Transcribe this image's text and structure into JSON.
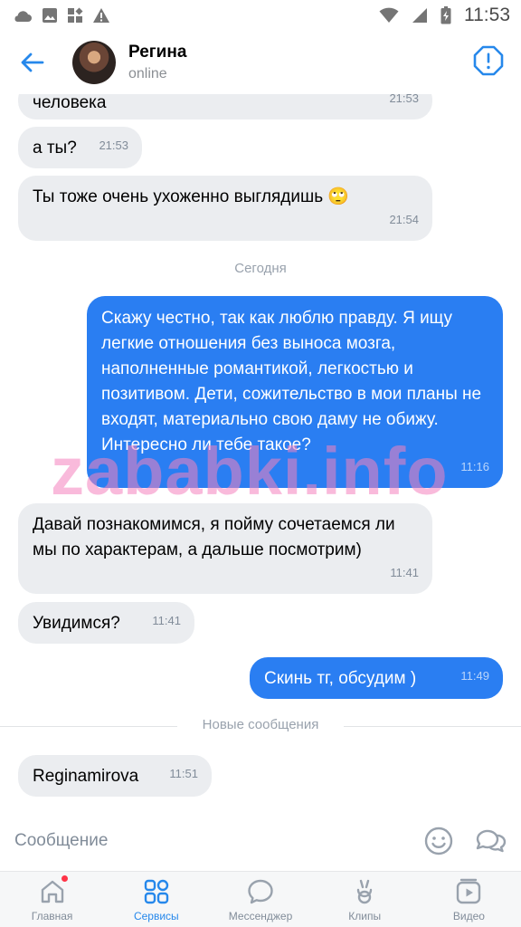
{
  "status_bar": {
    "time": "11:53"
  },
  "header": {
    "name": "Регина",
    "status": "online"
  },
  "messages": [
    {
      "text": "человека",
      "time": "21:53",
      "dir": "in"
    },
    {
      "text": "а ты?",
      "time": "21:53",
      "dir": "in"
    },
    {
      "text": "Ты тоже очень ухоженно выглядишь 🙄",
      "time": "21:54",
      "dir": "in"
    },
    {
      "text": "Скажу честно, так как люблю правду. Я ищу легкие отношения без выноса мозга, наполненные романтикой, легкостью и позитивом. Дети, сожительство в мои планы не входят, материально свою даму не обижу. Интересно ли тебе такое?",
      "time": "11:16",
      "dir": "out"
    },
    {
      "text": "Давай познакомимся, я пойму сочетаемся ли мы по характерам, а дальше посмотрим)",
      "time": "11:41",
      "dir": "in"
    },
    {
      "text": "Увидимся?",
      "time": "11:41",
      "dir": "in"
    },
    {
      "text": "Скинь тг, обсудим )",
      "time": "11:49",
      "dir": "out"
    },
    {
      "text": "Reginamirova",
      "time": "11:51",
      "dir": "in"
    }
  ],
  "separators": {
    "today": "Сегодня",
    "new_messages": "Новые сообщения"
  },
  "watermark": "zababki.info",
  "composer": {
    "placeholder": "Сообщение"
  },
  "tabs": [
    {
      "label": "Главная",
      "icon": "home-icon",
      "active": false,
      "badge": true
    },
    {
      "label": "Сервисы",
      "icon": "services-grid-icon",
      "active": true
    },
    {
      "label": "Мессенджер",
      "icon": "messenger-icon",
      "active": false
    },
    {
      "label": "Клипы",
      "icon": "clips-icon",
      "active": false
    },
    {
      "label": "Видео",
      "icon": "video-icon",
      "active": false
    }
  ],
  "colors": {
    "accent": "#2688eb",
    "outgoing_bubble": "#2a7ef2",
    "incoming_bubble": "#ebedf0",
    "badge": "#ff3347"
  }
}
